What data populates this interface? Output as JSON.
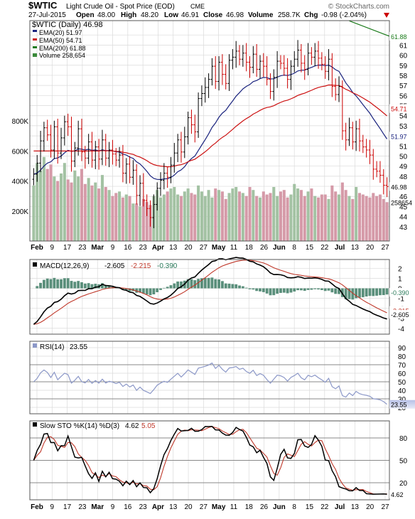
{
  "header": {
    "symbol": "$WTIC",
    "description": "Light Crude Oil - Spot Price (EOD)",
    "exchange": "CME",
    "watermark": "© StockCharts.com",
    "date": "27-Jul-2015",
    "open_label": "Open",
    "open": "48.00",
    "high_label": "High",
    "high": "48.20",
    "low_label": "Low",
    "low": "46.91",
    "close_label": "Close",
    "close": "46.98",
    "volume_label": "Volume",
    "volume": "258.7K",
    "chg_label": "Chg",
    "chg": "-0.98 (-2.04%)",
    "chg_icon": "down-triangle-icon"
  },
  "colors": {
    "up_candle": "#000000",
    "down_candle": "#cc0000",
    "ema20": "#1a237e",
    "ema50": "#cc1111",
    "ema200": "#1a7a1a",
    "vol_up": "#a3c2a3",
    "vol_down": "#d59aa8",
    "macd": "#000000",
    "signal": "#c0392b",
    "hist": "#5a8f7b",
    "rsi": "#8c98c8",
    "sto_k": "#000000",
    "sto_d": "#c0392b",
    "grid": "#dadada",
    "frame": "#555555"
  },
  "chart_data": [
    {
      "type": "candlestick",
      "title": "$WTIC Light Crude Oil - Spot Price (EOD) CME",
      "legend": {
        "price": "$WTIC (Daily) 46.98",
        "ema20": "EMA(20) 51.97",
        "ema50": "EMA(50) 54.71",
        "ema200": "EMA(200) 61.88",
        "volume": "Volume 258,654"
      },
      "x_ticks": [
        "Feb",
        "9",
        "17",
        "23",
        "Mar",
        "9",
        "16",
        "23",
        "Apr",
        "13",
        "20",
        "27",
        "May",
        "11",
        "18",
        "26",
        "Jun",
        "8",
        "15",
        "22",
        "Jul",
        "13",
        "20",
        "27"
      ],
      "y_ticks": [
        "43",
        "44",
        "45",
        "46",
        "47",
        "48",
        "49",
        "50",
        "51",
        "52",
        "53",
        "54",
        "55",
        "56",
        "57",
        "58",
        "59",
        "60",
        "61",
        "62"
      ],
      "ylim": [
        42,
        63
      ],
      "last_value_labels": [
        "61.88",
        "54.71",
        "51.97",
        "46.98"
      ],
      "volume_ticks": [
        "200K",
        "400K",
        "600K",
        "800K"
      ],
      "volume_last_label": "258654",
      "close": [
        48.2,
        49.3,
        51.5,
        52.8,
        52.1,
        50.6,
        52.9,
        50.3,
        51.8,
        53.4,
        52.9,
        49.5,
        50.8,
        52.7,
        50.4,
        49.8,
        51.4,
        49.6,
        50.9,
        49.7,
        51.6,
        49.8,
        50.6,
        50.2,
        49.6,
        50.1,
        48.3,
        49.2,
        47.9,
        48.6,
        46.1,
        47.3,
        45.6,
        44.8,
        43.9,
        45.2,
        46.8,
        47.6,
        48.3,
        47.9,
        49.1,
        50.3,
        51.6,
        50.4,
        51.9,
        53.8,
        53.1,
        52.4,
        55.7,
        56.2,
        56.8,
        57.6,
        58.9,
        57.4,
        59.3,
        58.1,
        57.2,
        59.5,
        59.8,
        60.4,
        59.6,
        60.2,
        59.3,
        58.8,
        60.1,
        58.6,
        59.4,
        58.9,
        57.6,
        56.4,
        57.8,
        59.4,
        59.2,
        58.7,
        57.6,
        58.9,
        59.6,
        60.5,
        59.2,
        58.6,
        60.2,
        59.8,
        60.4,
        59.7,
        59.1,
        58.4,
        59.6,
        56.9,
        56.1,
        56.9,
        52.5,
        51.6,
        52.8,
        51.4,
        52.7,
        51.5,
        50.9,
        50.6,
        50.1,
        48.7,
        48.5,
        48.1,
        47.1,
        46.98
      ],
      "volume_k": [
        370,
        520,
        470,
        560,
        480,
        510,
        430,
        400,
        450,
        520,
        410,
        390,
        470,
        430,
        480,
        380,
        420,
        370,
        390,
        350,
        440,
        360,
        340,
        300,
        320,
        330,
        290,
        310,
        300,
        250,
        250,
        230,
        280,
        260,
        240,
        300,
        340,
        290,
        310,
        330,
        350,
        360,
        310,
        300,
        330,
        350,
        320,
        310,
        370,
        330,
        300,
        340,
        290,
        350,
        340,
        330,
        280,
        320,
        350,
        360,
        330,
        320,
        300,
        360,
        340,
        300,
        290,
        330,
        310,
        320,
        360,
        300,
        330,
        340,
        290,
        310,
        380,
        350,
        340,
        300,
        330,
        350,
        300,
        290,
        310,
        310,
        280,
        370,
        330,
        310,
        390,
        340,
        300,
        280,
        360,
        320,
        310,
        300,
        290,
        320,
        300,
        310,
        280,
        259
      ],
      "ema20_last": 51.97,
      "ema50_last": 54.71,
      "ema200_last": 61.88
    },
    {
      "type": "line",
      "title": "MACD(12,26,9)",
      "legend": {
        "macd": "-2.605",
        "signal": "-2.215",
        "hist": "-0.390"
      },
      "y_ticks": [
        "-4",
        "-3",
        "-2",
        "-1",
        "0",
        "1",
        "2"
      ],
      "ylim": [
        -4.3,
        2.6
      ],
      "last_value_labels": [
        "-0.390",
        "-2.215",
        "-2.605"
      ]
    },
    {
      "type": "line",
      "title": "RSI(14)",
      "last_value": "23.55",
      "y_ticks": [
        "20",
        "30",
        "40",
        "50",
        "60",
        "70",
        "80",
        "90"
      ],
      "ylim": [
        15,
        95
      ],
      "last_value_labels": [
        "23.55"
      ]
    },
    {
      "type": "line",
      "title": "Slow STO %K(14) %D(3)",
      "legend": {
        "k": "4.62",
        "d": "5.05"
      },
      "y_ticks": [
        "20",
        "50",
        "80"
      ],
      "ylim": [
        0,
        100
      ],
      "last_value_labels": [
        "4.62"
      ]
    }
  ]
}
